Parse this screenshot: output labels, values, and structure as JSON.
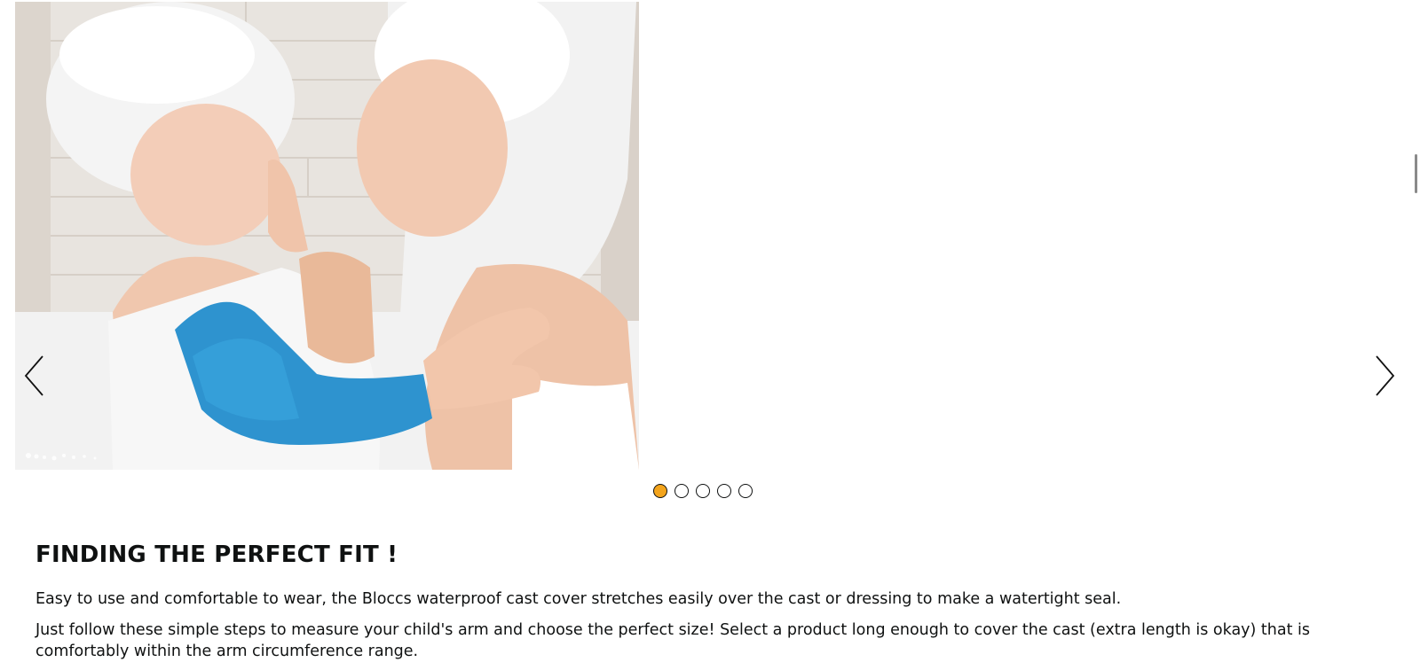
{
  "carousel": {
    "image_alt": "Mother and child wrapped in white towels, child wearing a blue waterproof arm cast cover",
    "prev_label": "Previous",
    "next_label": "Next",
    "dots": [
      {
        "label": "Slide 1",
        "active": true
      },
      {
        "label": "Slide 2",
        "active": false
      },
      {
        "label": "Slide 3",
        "active": false
      },
      {
        "label": "Slide 4",
        "active": false
      },
      {
        "label": "Slide 5",
        "active": false
      }
    ],
    "active_color": "#f3a41c"
  },
  "section": {
    "heading": "FINDING THE PERFECT FIT !",
    "paragraph1": "Easy to use and comfortable to wear, the Bloccs waterproof cast cover stretches easily over the cast or dressing to make a watertight seal.",
    "paragraph2": "Just follow these simple steps to measure your child's arm and choose the perfect size! Select a product long enough to cover the cast (extra length is okay) that is comfortably within the arm circumference range."
  }
}
